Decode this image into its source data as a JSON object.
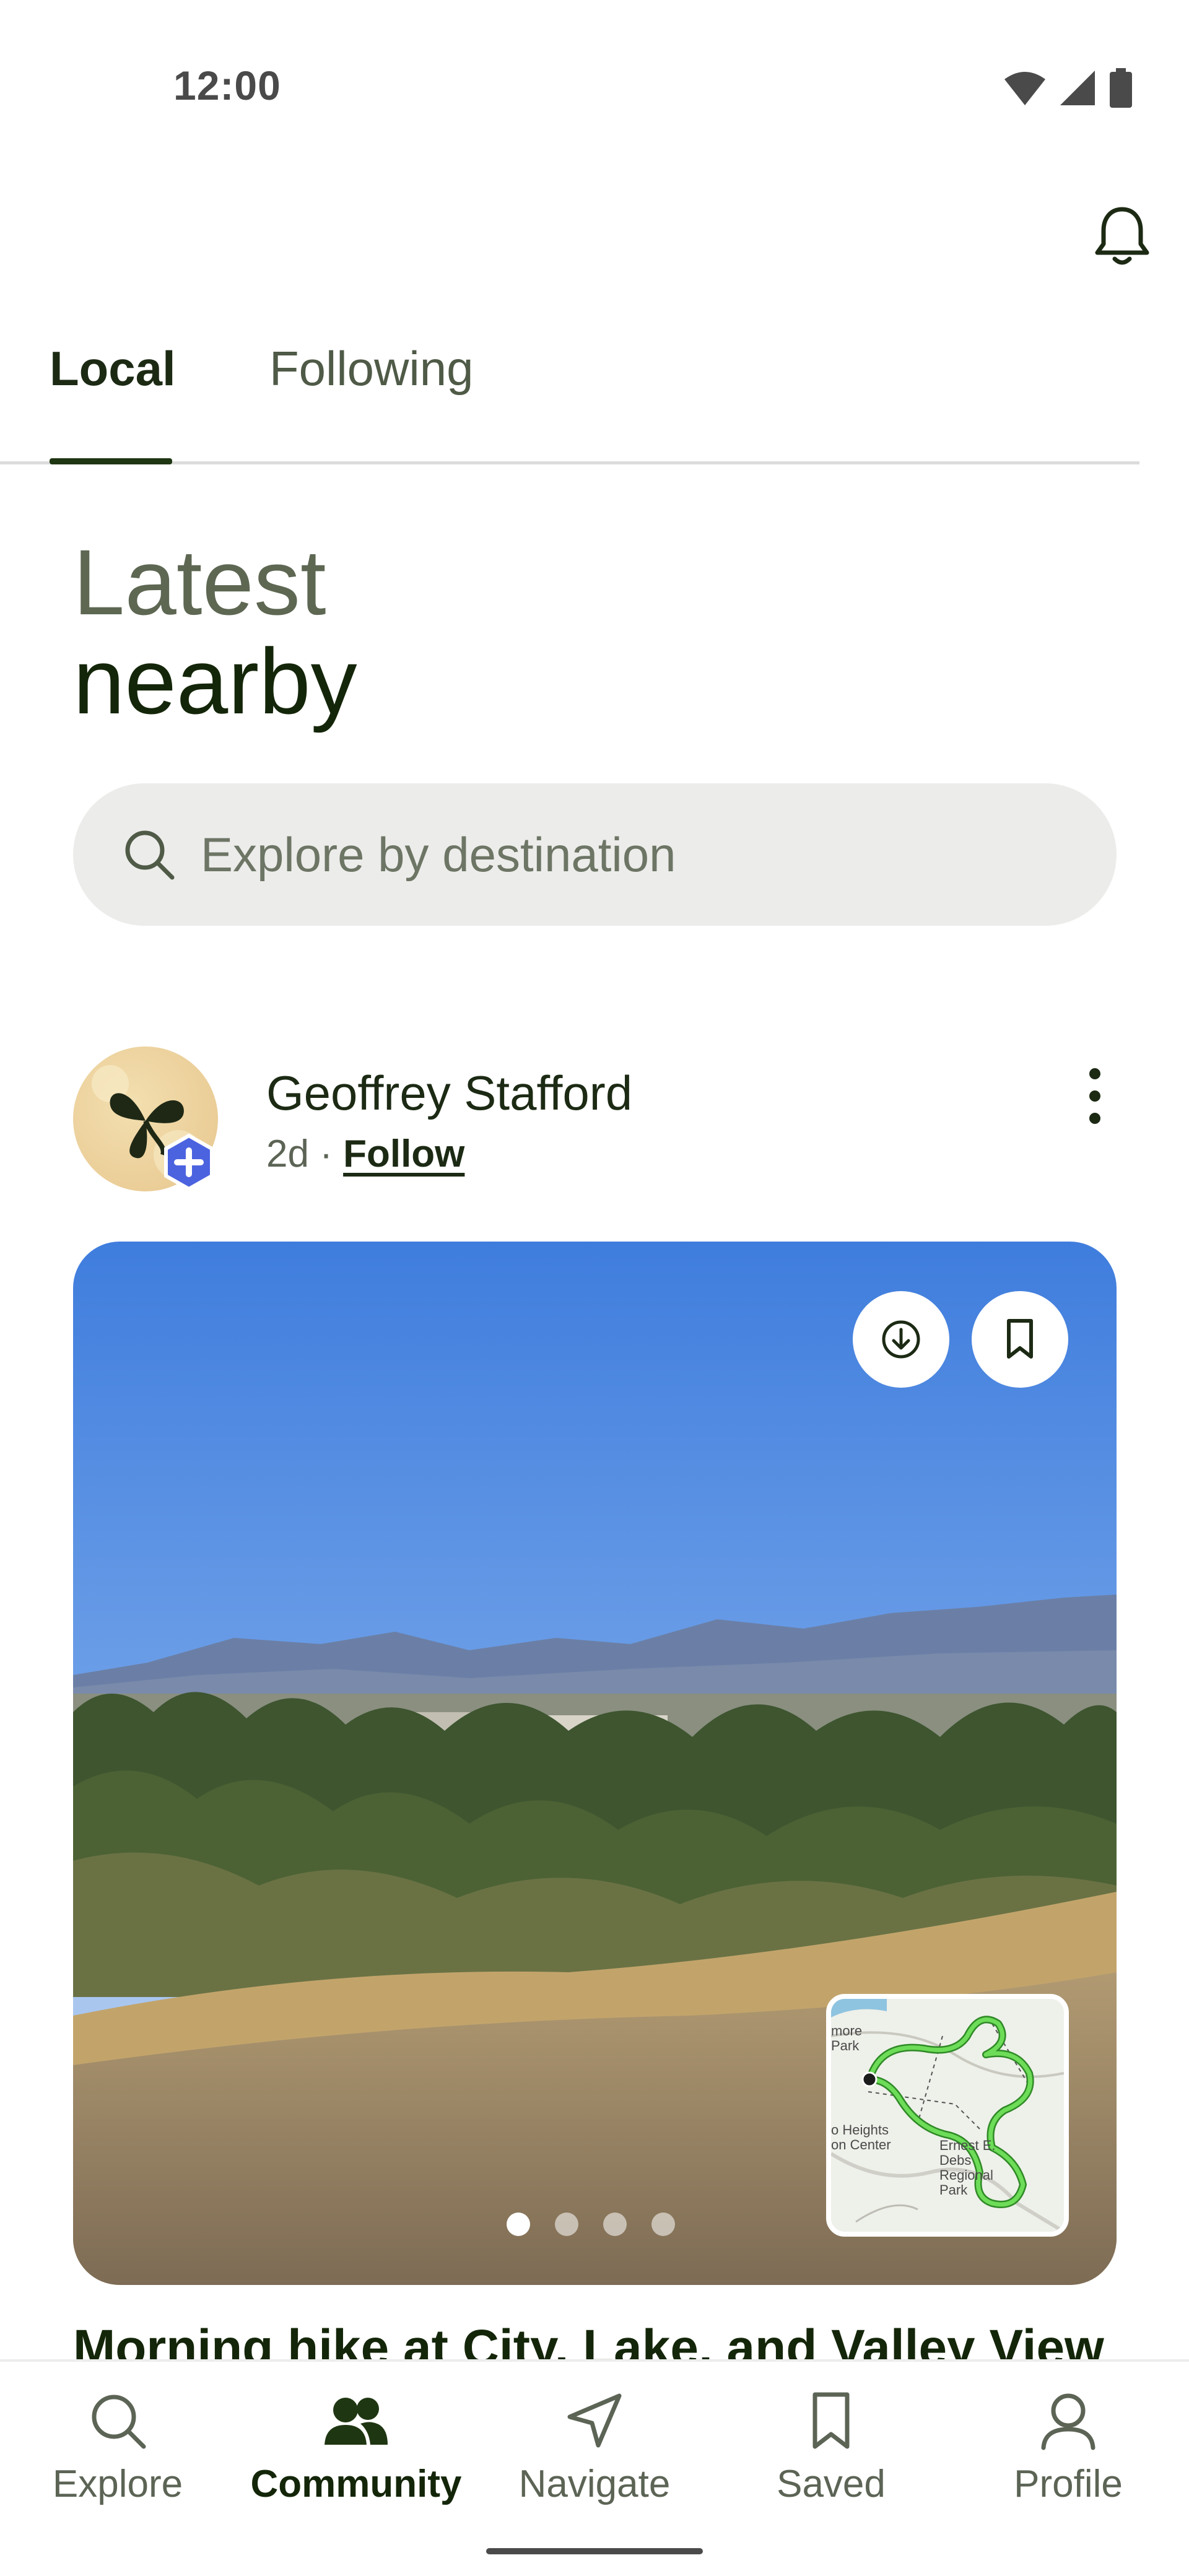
{
  "status_bar": {
    "time": "12:00"
  },
  "tabs": [
    {
      "label": "Local",
      "active": true
    },
    {
      "label": "Following",
      "active": false
    }
  ],
  "heading": {
    "line1": "Latest",
    "line2": "nearby"
  },
  "search": {
    "placeholder": "Explore by destination"
  },
  "post": {
    "author": "Geoffrey Stafford",
    "age": "2d",
    "separator": "·",
    "follow_label": "Follow",
    "title": "Morning hike at City, Lake, and Valley View",
    "photo_count": 4,
    "active_photo": 1,
    "map_labels": {
      "park": "more Park",
      "center": "o Heights on Center",
      "debs": "Ernest E. Debs Regional Park"
    }
  },
  "bottom_nav": [
    {
      "label": "Explore",
      "icon": "search-icon",
      "active": false
    },
    {
      "label": "Community",
      "icon": "community-icon",
      "active": true
    },
    {
      "label": "Navigate",
      "icon": "navigate-icon",
      "active": false
    },
    {
      "label": "Saved",
      "icon": "bookmark-icon",
      "active": false
    },
    {
      "label": "Profile",
      "icon": "profile-icon",
      "active": false
    }
  ],
  "colors": {
    "accent": "#1f3612",
    "route": "#58c94a",
    "badge": "#4c63e0"
  }
}
